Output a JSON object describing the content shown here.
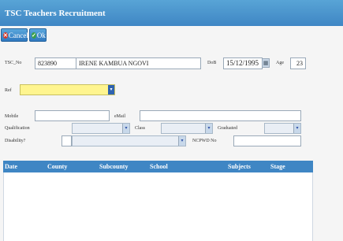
{
  "window": {
    "title": "TSC Teachers Recruitment"
  },
  "toolbar": {
    "cancel_label": "Cancel",
    "ok_label": "Ok"
  },
  "form": {
    "tsc_no_label": "TSC_No",
    "tsc_no_value": "823890",
    "name_value": "IRENE KAMBUA NGOVI",
    "dob_label": "DoB",
    "dob_value": "15/12/1995",
    "age_label": "Age",
    "age_value": "23",
    "ref_label": "Ref",
    "mobile_label": "Mobile",
    "email_label": "eMail",
    "qualification_label": "Qualification",
    "class_label": "Class",
    "graduated_label": "Graduated",
    "disability_label": "Disability?",
    "ncpwd_label": "NCPWD No"
  },
  "grid": {
    "columns": [
      "Date",
      "County",
      "Subcounty",
      "School",
      "Subjects",
      "Stage"
    ]
  },
  "colors": {
    "accent": "#3f86c4",
    "highlight": "#fff58f"
  }
}
